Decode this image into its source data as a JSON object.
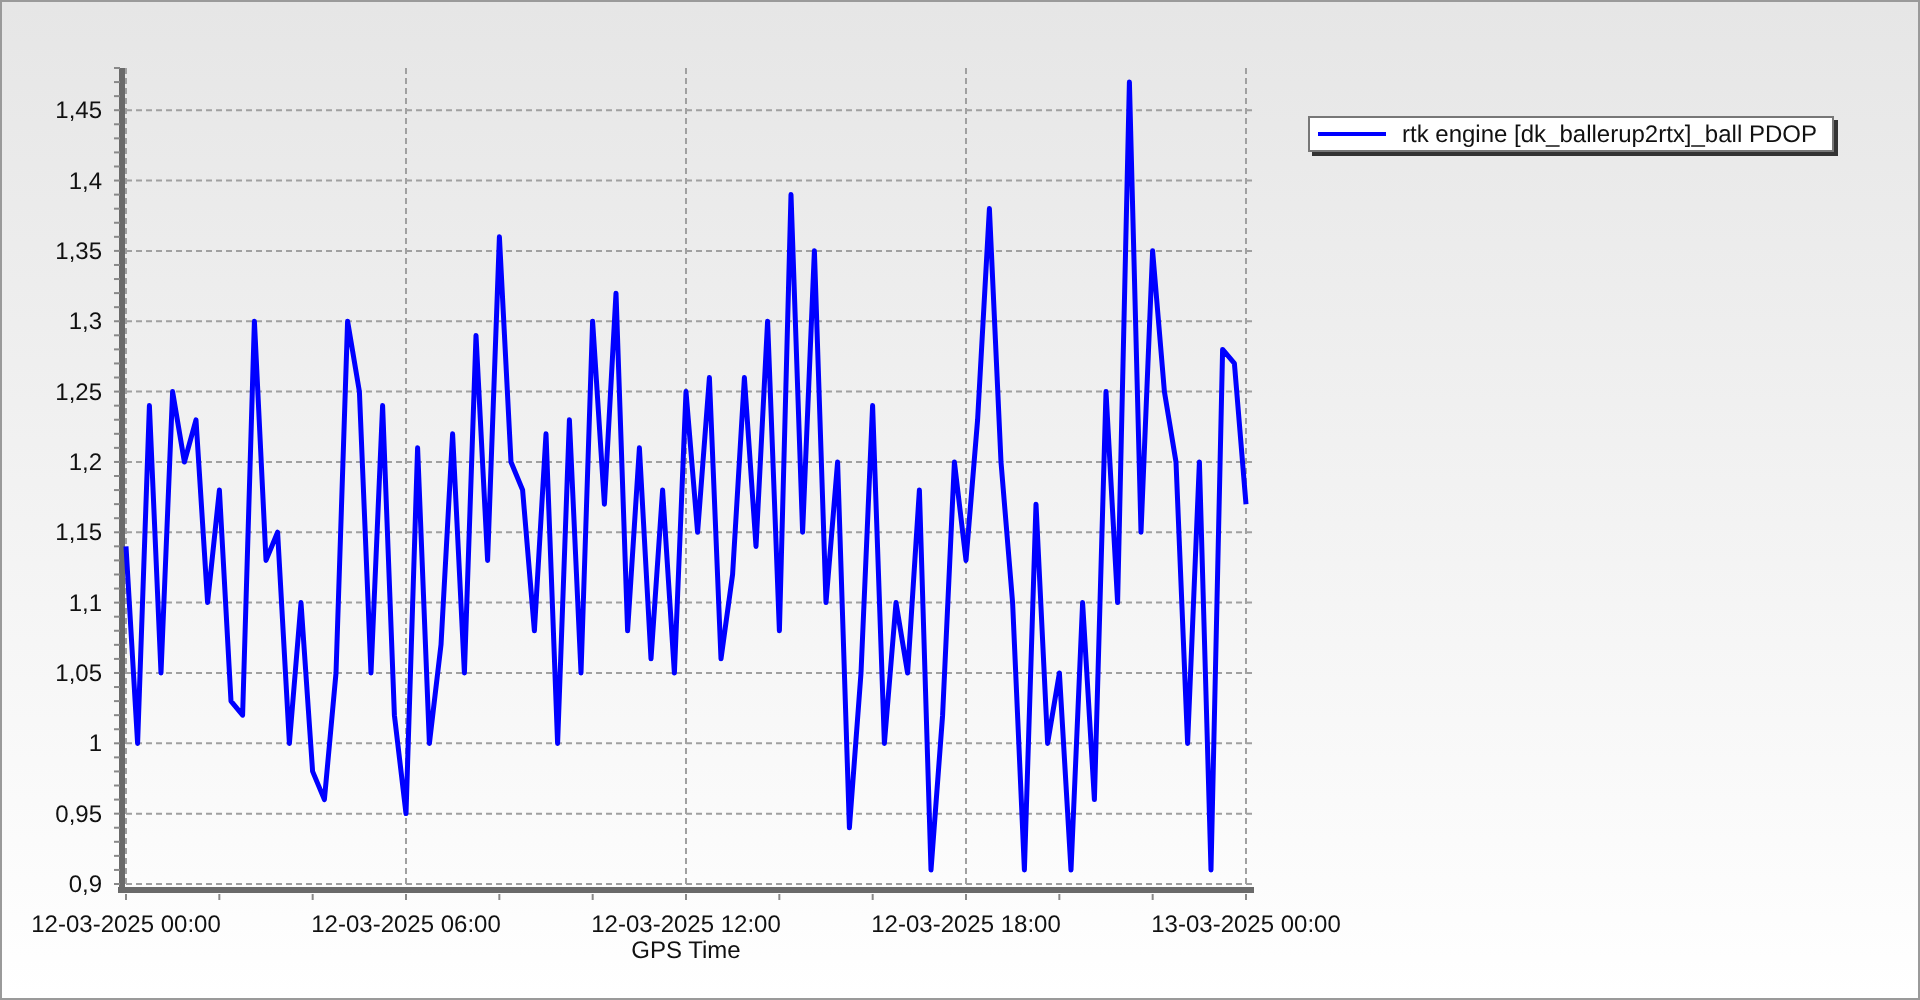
{
  "chart": {
    "chart_data": {
      "type": "line",
      "xlabel": "GPS Time",
      "ylim": [
        0.9,
        1.48
      ],
      "grid": true,
      "yticks": [
        {
          "value": 0.9,
          "label": "0,9"
        },
        {
          "value": 0.95,
          "label": "0,95"
        },
        {
          "value": 1,
          "label": "1"
        },
        {
          "value": 1.05,
          "label": "1,05"
        },
        {
          "value": 1.1,
          "label": "1,1"
        },
        {
          "value": 1.15,
          "label": "1,15"
        },
        {
          "value": 1.2,
          "label": "1,2"
        },
        {
          "value": 1.25,
          "label": "1,25"
        },
        {
          "value": 1.3,
          "label": "1,3"
        },
        {
          "value": 1.35,
          "label": "1,35"
        },
        {
          "value": 1.4,
          "label": "1,4"
        },
        {
          "value": 1.45,
          "label": "1,45"
        }
      ],
      "categories": [
        "12-03-2025 00:00",
        null,
        null,
        null,
        null,
        null,
        null,
        null,
        null,
        null,
        null,
        null,
        null,
        null,
        null,
        null,
        null,
        null,
        null,
        null,
        null,
        null,
        null,
        null,
        "12-03-2025 06:00",
        null,
        null,
        null,
        null,
        null,
        null,
        null,
        null,
        null,
        null,
        null,
        null,
        null,
        null,
        null,
        null,
        null,
        null,
        null,
        null,
        null,
        null,
        null,
        "12-03-2025 12:00",
        null,
        null,
        null,
        null,
        null,
        null,
        null,
        null,
        null,
        null,
        null,
        null,
        null,
        null,
        null,
        null,
        null,
        null,
        null,
        null,
        null,
        null,
        null,
        "12-03-2025 18:00",
        null,
        null,
        null,
        null,
        null,
        null,
        null,
        null,
        null,
        null,
        null,
        null,
        null,
        null,
        null,
        null,
        null,
        null,
        null,
        null,
        null,
        null,
        null,
        "13-03-2025 00:00"
      ],
      "series": [
        {
          "name": "rtk engine [dk_ballerup2rtx]_ball PDOP",
          "color": "#0000ff",
          "values": [
            1.14,
            1.0,
            1.24,
            1.05,
            1.25,
            1.2,
            1.23,
            1.1,
            1.18,
            1.03,
            1.02,
            1.3,
            1.13,
            1.15,
            1.0,
            1.1,
            0.98,
            0.96,
            1.05,
            1.3,
            1.25,
            1.05,
            1.24,
            1.02,
            0.95,
            1.21,
            1.0,
            1.07,
            1.22,
            1.05,
            1.29,
            1.13,
            1.36,
            1.2,
            1.18,
            1.08,
            1.22,
            1.0,
            1.23,
            1.05,
            1.3,
            1.17,
            1.32,
            1.08,
            1.21,
            1.06,
            1.18,
            1.05,
            1.25,
            1.15,
            1.26,
            1.06,
            1.12,
            1.26,
            1.14,
            1.3,
            1.08,
            1.39,
            1.15,
            1.35,
            1.1,
            1.2,
            0.94,
            1.05,
            1.24,
            1.0,
            1.1,
            1.05,
            1.18,
            0.91,
            1.02,
            1.2,
            1.13,
            1.23,
            1.38,
            1.2,
            1.1,
            0.91,
            1.17,
            1.0,
            1.05,
            0.91,
            1.1,
            0.96,
            1.25,
            1.1,
            1.47,
            1.15,
            1.35,
            1.25,
            1.2,
            1.0,
            1.2,
            0.91,
            1.28,
            1.27,
            1.17
          ]
        }
      ]
    }
  }
}
